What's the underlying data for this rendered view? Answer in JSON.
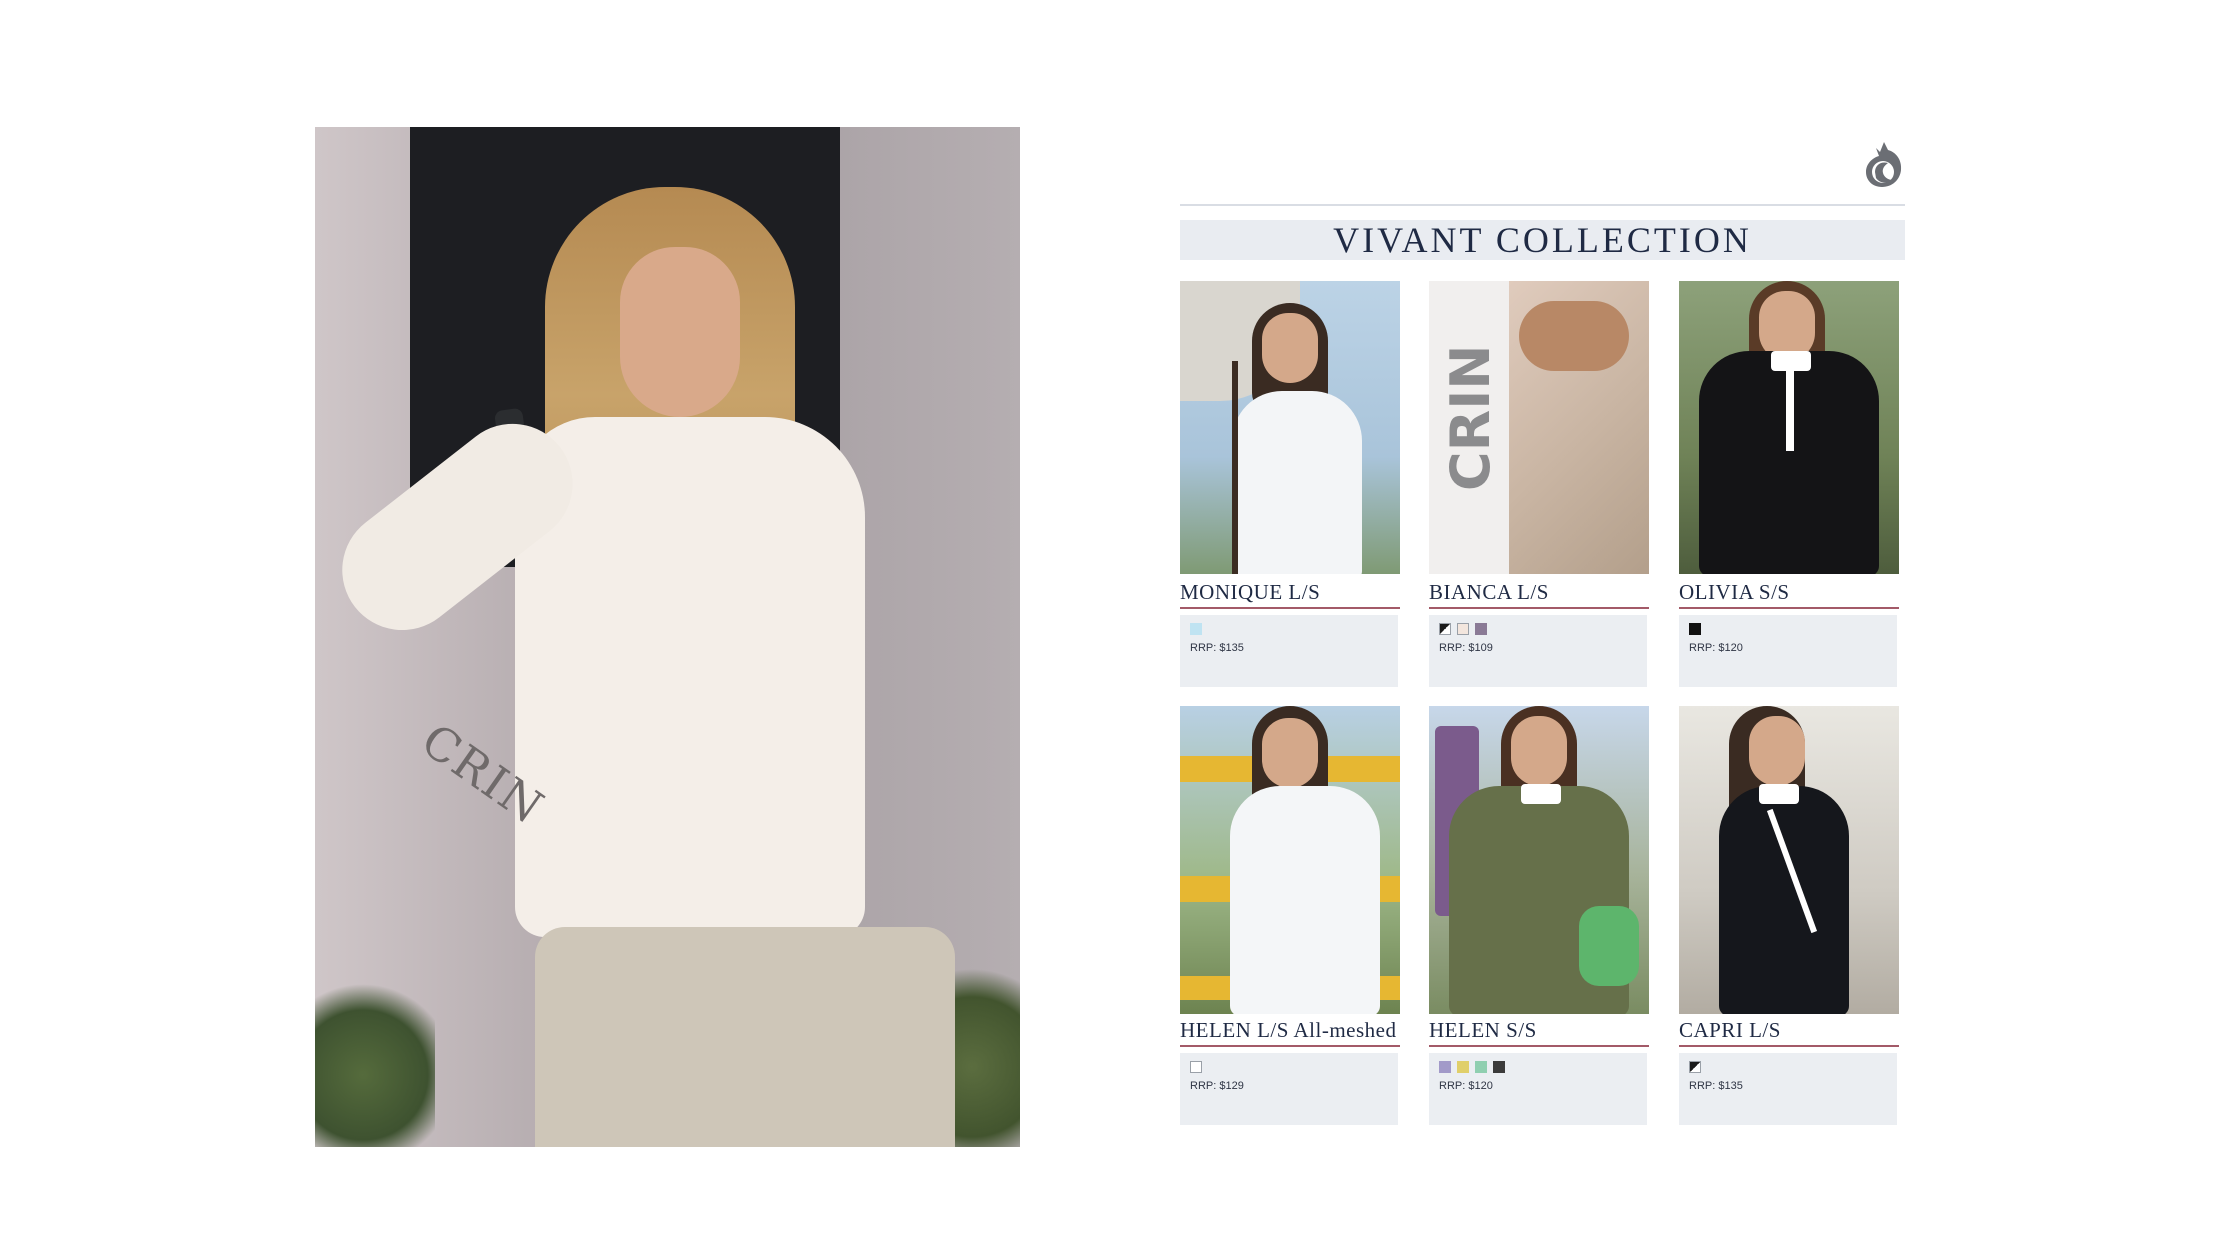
{
  "hero": {
    "sleeve_text": "CRIN"
  },
  "catalog": {
    "title": "VIVANT COLLECTION",
    "products": [
      {
        "name": "MONIQUE L/S",
        "price": "RRP: $135",
        "swatches": [
          "#bfe3f2"
        ],
        "photo": "white long-sleeve show shirt with horse"
      },
      {
        "name": "BIANCA L/S",
        "price": "RRP: $109",
        "swatches": [
          "#1b1b1b",
          "#f3e6de",
          "#8a7a96"
        ],
        "sleeve_text": "CRIN"
      },
      {
        "name": "OLIVIA S/S",
        "price": "RRP: $120",
        "swatches": [
          "#111111"
        ]
      },
      {
        "name": "HELEN L/S All-meshed",
        "price": "RRP: $129",
        "swatches": [
          "#ffffff"
        ]
      },
      {
        "name": "HELEN S/S",
        "price": "RRP: $120",
        "swatches": [
          "#a29ac9",
          "#e0cf6a",
          "#8fcfb0",
          "#3b3b3b"
        ]
      },
      {
        "name": "CAPRI L/S",
        "price": "RRP: $135",
        "swatches": [
          "#1b1b1b"
        ]
      }
    ]
  },
  "colors": {
    "accent_rule": "#a35a68",
    "title_band": "#e9ecf1",
    "navy": "#1f2a44"
  },
  "icons": {
    "logo": "horse-head-logo"
  }
}
